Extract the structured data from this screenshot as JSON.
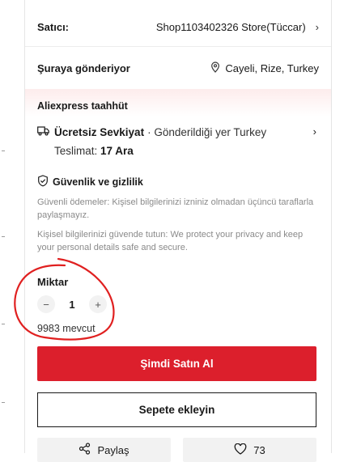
{
  "seller": {
    "label": "Satıcı:",
    "value": "Shop1103402326 Store(Tüccar)"
  },
  "ship_to": {
    "label": "Şuraya gönderiyor",
    "value": "Cayeli, Rize, Turkey"
  },
  "commitment": {
    "title": "Aliexpress taahhüt",
    "shipping_label": "Ücretsiz Sevkiyat",
    "shipping_dest": "· Gönderildiği yer Turkey",
    "delivery_prefix": "Teslimat: ",
    "delivery_date": "17 Ara"
  },
  "security": {
    "title": "Güvenlik ve gizlilik",
    "para1": "Güvenli ödemeler: Kişisel bilgilerinizi izniniz olmadan üçüncü taraflarla paylaşmayız.",
    "para2": "Kişisel bilgilerinizi güvende tutun: We protect your privacy and keep your personal details safe and secure."
  },
  "quantity": {
    "label": "Miktar",
    "minus": "−",
    "value": "1",
    "plus": "+",
    "stock": "9983 mevcut"
  },
  "actions": {
    "buy_now": "Şimdi Satın Al",
    "add_to_cart": "Sepete ekleyin",
    "share": "Paylaş",
    "likes": "73"
  },
  "colors": {
    "accent": "#dc1f2c",
    "annotation": "#e02020"
  }
}
